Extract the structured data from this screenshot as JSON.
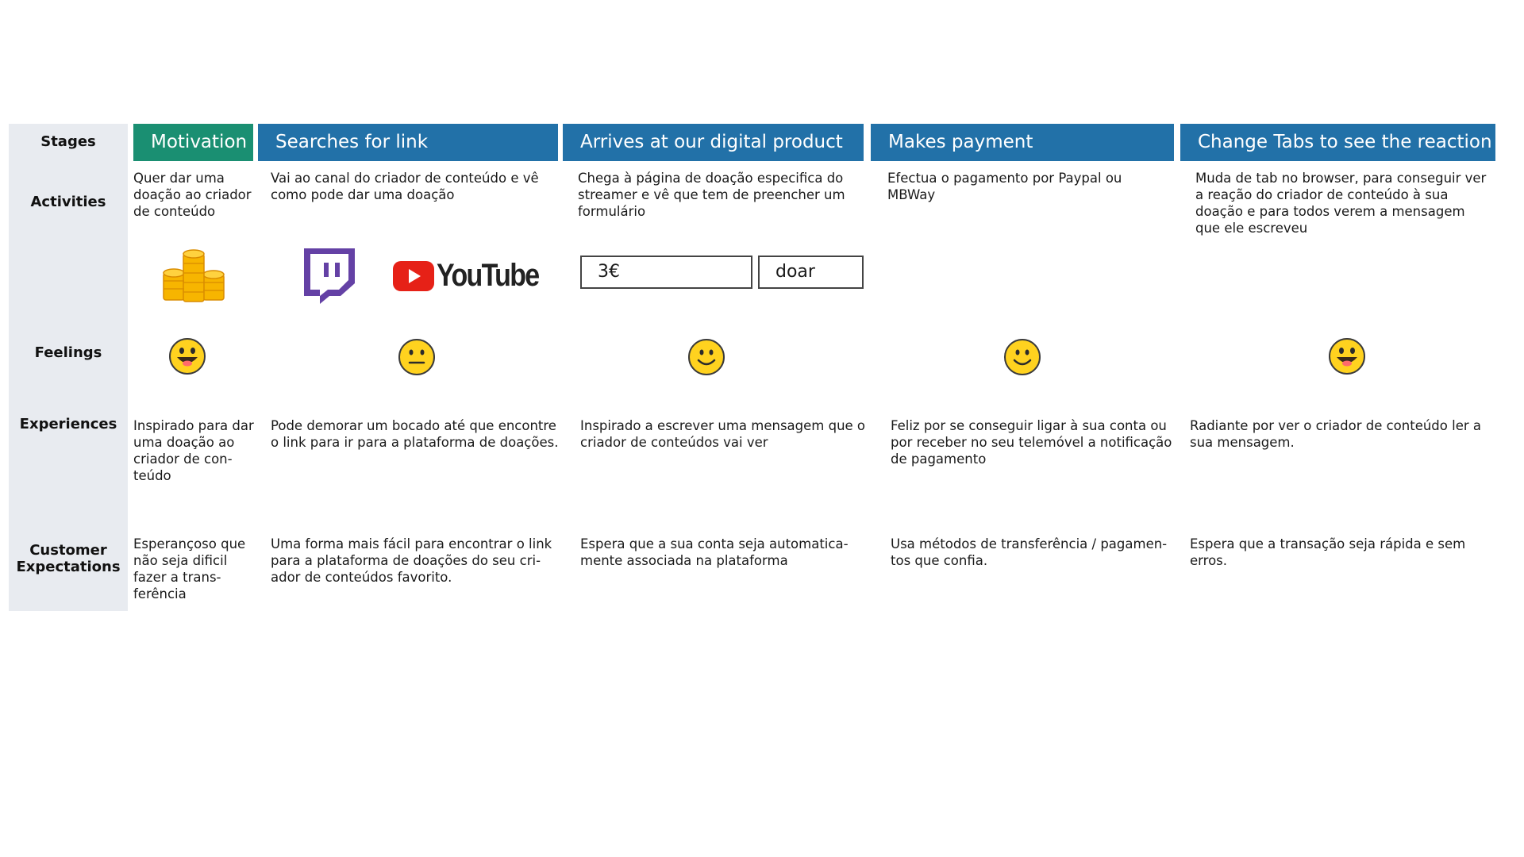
{
  "rows": {
    "stages": "Stages",
    "activities": "Activities",
    "feelings": "Feelings",
    "experiences": "Experiences",
    "expectations": "Customer\nExpectations"
  },
  "stages": [
    {
      "title": "Motivation",
      "activity": "Quer dar uma doação ao criador de conteúdo",
      "feeling": "happy-tongue-icon",
      "experience": "Inspirado para dar uma doação ao criador de con-teúdo",
      "expectation": "Esperançoso que não seja dificil fazer a trans-ferência"
    },
    {
      "title": "Searches for  link",
      "activity": "Vai ao canal do criador de conteúdo e vê como pode dar uma doação",
      "feeling": "neutral-face-icon",
      "experience": "Pode demorar um bocado até que encontre o link para ir para a plataforma de doações.",
      "expectation": "Uma forma mais fácil para encontrar o link para a plataforma de doações do seu cri-ador de conteúdos favorito."
    },
    {
      "title": "Arrives at our digital product",
      "activity": "Chega à página de doação especifica do streamer e vê que tem de preencher um formulário",
      "feeling": "smiling-face-icon",
      "experience": "Inspirado a escrever uma mensagem que o criador de conteúdos vai ver",
      "expectation": "Espera que a sua conta seja automatica-mente associada na plataforma"
    },
    {
      "title": "Makes payment",
      "activity": "Efectua o pagamento por Paypal ou MBWay",
      "feeling": "smiling-face-icon",
      "experience": "Feliz por se conseguir ligar à sua conta ou por receber no seu telemóvel a notificação de pagamento",
      "expectation": "Usa métodos de transferência / pagamen-tos que confia."
    },
    {
      "title": "Change Tabs to see the reaction",
      "activity": "Muda de tab no browser,  para conseguir ver a reação do criador de conteúdo à sua doação e para todos verem a mensagem que ele escreveu",
      "feeling": "happy-tongue-icon",
      "experience": "Radiante por ver o criador de conteúdo ler a sua mensagem.",
      "expectation": "Espera que a transação seja rápida e sem erros."
    }
  ],
  "form": {
    "amount": "3€",
    "button": "doar"
  },
  "youtube": {
    "wordmark": "YouTube"
  },
  "colors": {
    "green_stage": "#1a8f72",
    "blue_stage": "#2271a8",
    "sidebar": "#e8ebf0",
    "twitch": "#6441a5",
    "youtube": "#e62117"
  }
}
